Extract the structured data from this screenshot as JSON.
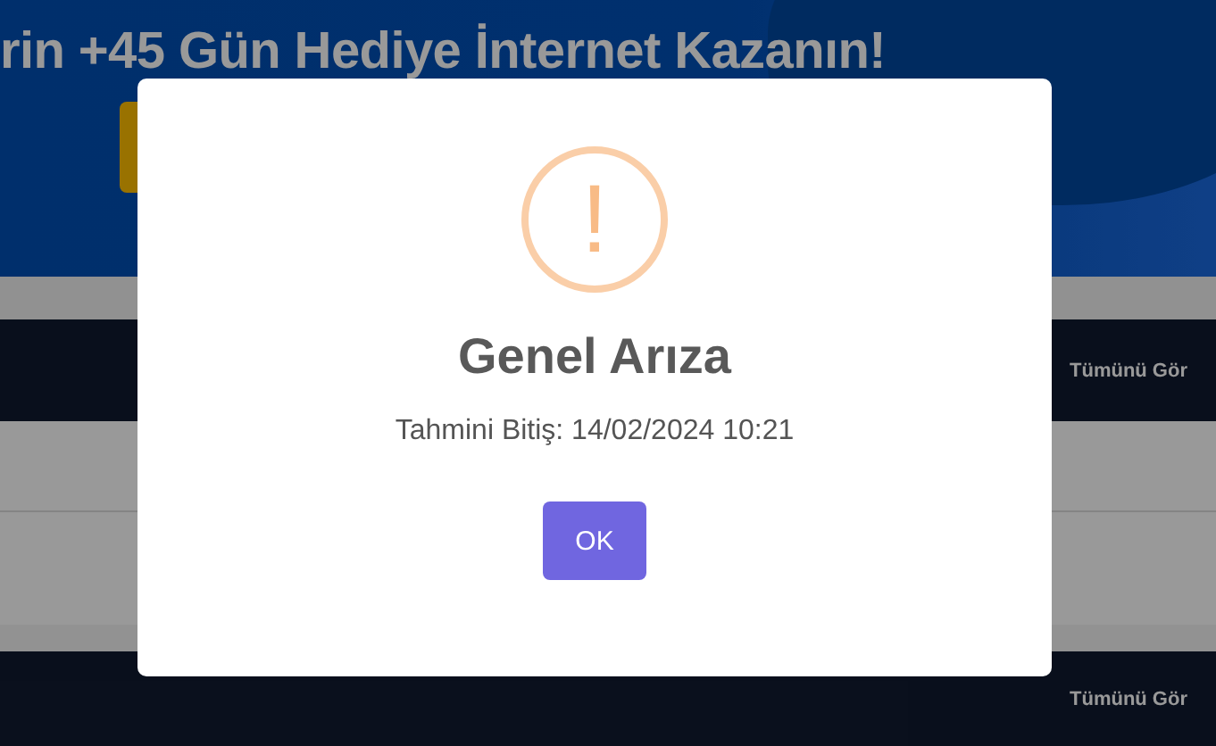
{
  "banner": {
    "headline": "rin +45 Gün Hediye İnternet Kazanın!"
  },
  "sections": [
    {
      "link": "Tümünü Gör"
    },
    {
      "link": "Tümünü Gör"
    }
  ],
  "dialog": {
    "icon_symbol": "!",
    "title": "Genel Arıza",
    "message": "Tahmini Bitiş: 14/02/2024 10:21",
    "button": "OK"
  }
}
